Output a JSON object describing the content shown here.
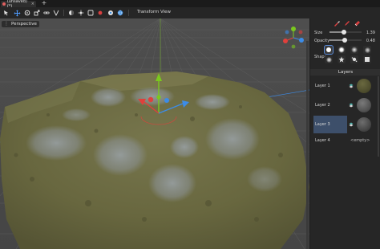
{
  "tabs": [
    {
      "label": "(unsaved)(*)",
      "close_symbol": "×"
    }
  ],
  "new_tab_symbol": "+",
  "toolbar": {
    "icons": [
      "select-arrow-icon",
      "move-icon",
      "rotate-icon",
      "scale-icon",
      "link-icon",
      "snap-icon",
      "view-icon",
      "light-icon",
      "material-icon",
      "environment-icon",
      "paint-icon",
      "globe-icon"
    ],
    "menus": [
      "Transform",
      "View"
    ]
  },
  "viewport": {
    "mode_label": "Perspective",
    "menu_symbol": "⋮"
  },
  "panel": {
    "tools": [
      "brush-icon",
      "pencil-icon",
      "eraser-icon"
    ],
    "size": {
      "label": "Size",
      "value": "1.39",
      "fraction": 0.45
    },
    "opacity": {
      "label": "Opacity",
      "value": "0.48",
      "fraction": 0.48
    },
    "shape": {
      "label": "Shape",
      "selected_index": 0,
      "count": 8
    },
    "layers_title": "Layers",
    "layers": [
      {
        "name": "Layer 1",
        "selected": false,
        "thumb_color": "#4b4a2a"
      },
      {
        "name": "Layer 2",
        "selected": false,
        "thumb_color": "#5a5a5a"
      },
      {
        "name": "Layer 3",
        "selected": true,
        "thumb_color": "#4a4a4a"
      }
    ],
    "empty_layer": {
      "name": "Layer 4",
      "value": "<empty>"
    }
  },
  "colors": {
    "accent": "#4f9cff",
    "terrain": "#6c6b46",
    "grid": "#6a6a6a",
    "axis_x": "#e0403c",
    "axis_y": "#7ac81e",
    "axis_z": "#3c8ce8"
  }
}
